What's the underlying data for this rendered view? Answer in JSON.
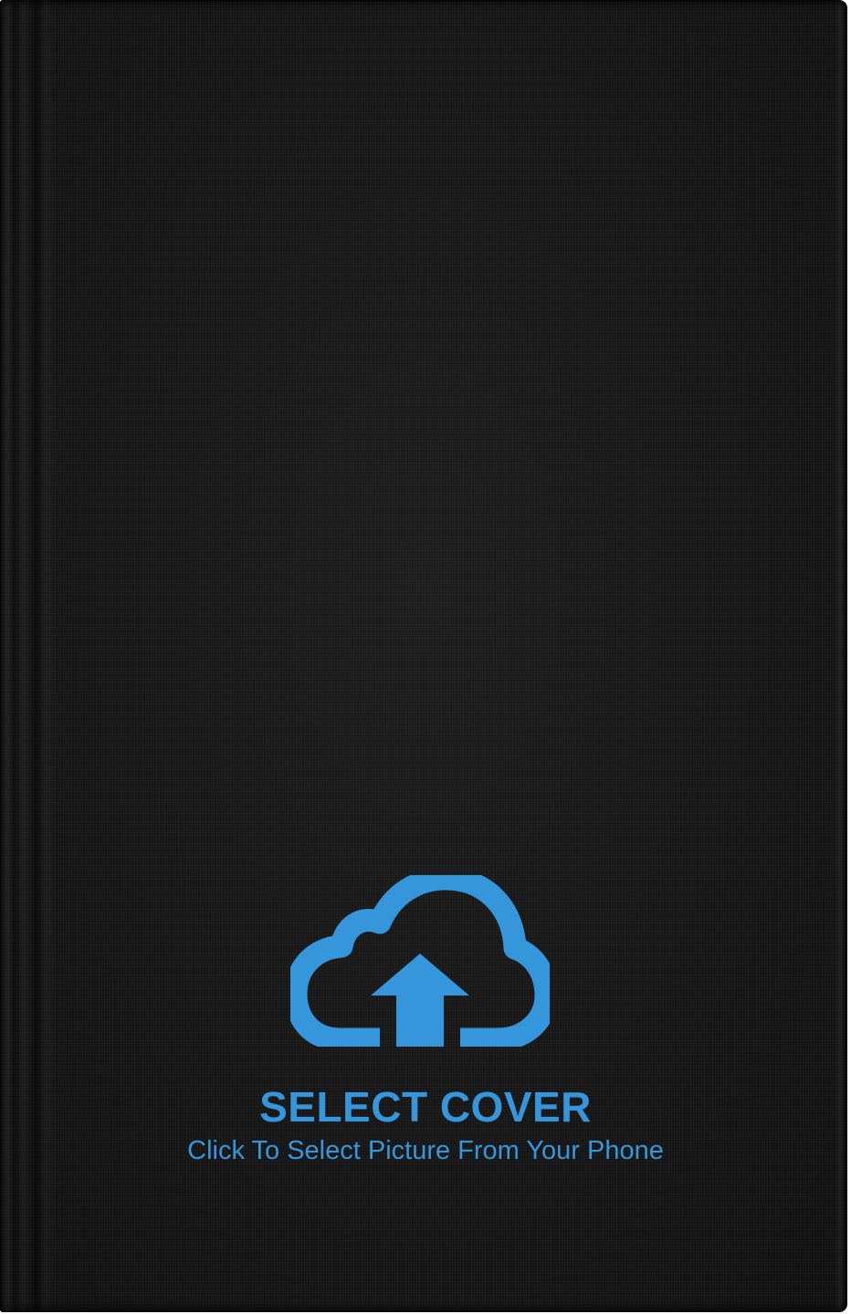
{
  "cover": {
    "title": "SELECT COVER",
    "subtitle": "Click To Select Picture From Your Phone",
    "icon": "cloud-upload-icon",
    "accent_color": "#3596dc",
    "background_color": "#151515"
  }
}
